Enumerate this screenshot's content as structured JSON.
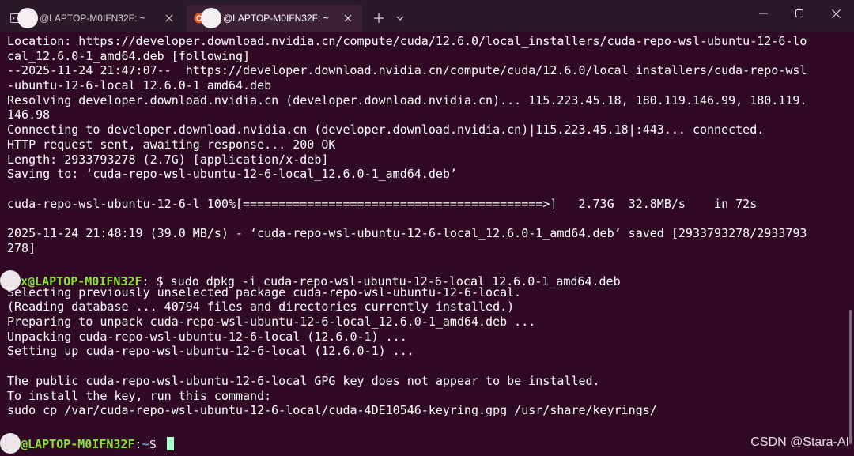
{
  "tabs": [
    {
      "title": "@LAPTOP-M0IFN32F: ~",
      "active": false,
      "icon": "terminal-icon"
    },
    {
      "title": "@LAPTOP-M0IFN32F: ~",
      "active": true,
      "icon": "ubuntu-icon"
    }
  ],
  "window_controls": {
    "minimize": "minimize-icon",
    "maximize": "maximize-icon",
    "close": "close-icon"
  },
  "terminal": {
    "lines": [
      "Location: https://developer.download.nvidia.cn/compute/cuda/12.6.0/local_installers/cuda-repo-wsl-ubuntu-12-6-lo",
      "cal_12.6.0-1_amd64.deb [following]",
      "--2025-11-24 21:47:07--  https://developer.download.nvidia.cn/compute/cuda/12.6.0/local_installers/cuda-repo-wsl",
      "-ubuntu-12-6-local_12.6.0-1_amd64.deb",
      "Resolving developer.download.nvidia.cn (developer.download.nvidia.cn)... 115.223.45.18, 180.119.146.99, 180.119.",
      "146.98",
      "Connecting to developer.download.nvidia.cn (developer.download.nvidia.cn)|115.223.45.18|:443... connected.",
      "HTTP request sent, awaiting response... 200 OK",
      "Length: 2933793278 (2.7G) [application/x-deb]",
      "Saving to: ‘cuda-repo-wsl-ubuntu-12-6-local_12.6.0-1_amd64.deb’",
      "",
      "cuda-repo-wsl-ubuntu-12-6-l 100%[==========================================>]   2.73G  32.8MB/s    in 72s",
      "",
      "2025-11-24 21:48:19 (39.0 MB/s) - ‘cuda-repo-wsl-ubuntu-12-6-local_12.6.0-1_amd64.deb’ saved [2933793278/2933793",
      "278]",
      ""
    ],
    "prompt1": {
      "user": "x@LAPTOP-M0IFN32F",
      "path": "",
      "dollar": ": $ ",
      "command": "sudo dpkg -i cuda-repo-wsl-ubuntu-12-6-local_12.6.0-1_amd64.deb"
    },
    "lines2": [
      "Selecting previously unselected package cuda-repo-wsl-ubuntu-12-6-local.",
      "(Reading database ... 40794 files and directories currently installed.)",
      "Preparing to unpack cuda-repo-wsl-ubuntu-12-6-local_12.6.0-1_amd64.deb ...",
      "Unpacking cuda-repo-wsl-ubuntu-12-6-local (12.6.0-1) ...",
      "Setting up cuda-repo-wsl-ubuntu-12-6-local (12.6.0-1) ...",
      "",
      "The public cuda-repo-wsl-ubuntu-12-6-local GPG key does not appear to be installed.",
      "To install the key, run this command:",
      "sudo cp /var/cuda-repo-wsl-ubuntu-12-6-local/cuda-4DE10546-keyring.gpg /usr/share/keyrings/",
      ""
    ],
    "prompt2": {
      "user": "@LAPTOP-M0IFN32F",
      "colon": ":",
      "path": "~",
      "dollar": "$ "
    }
  },
  "watermark": "CSDN @Stara-AI",
  "colors": {
    "background": "#300a24",
    "prompt_user": "#8ae234",
    "prompt_path": "#729fcf",
    "text": "#ffffff"
  }
}
